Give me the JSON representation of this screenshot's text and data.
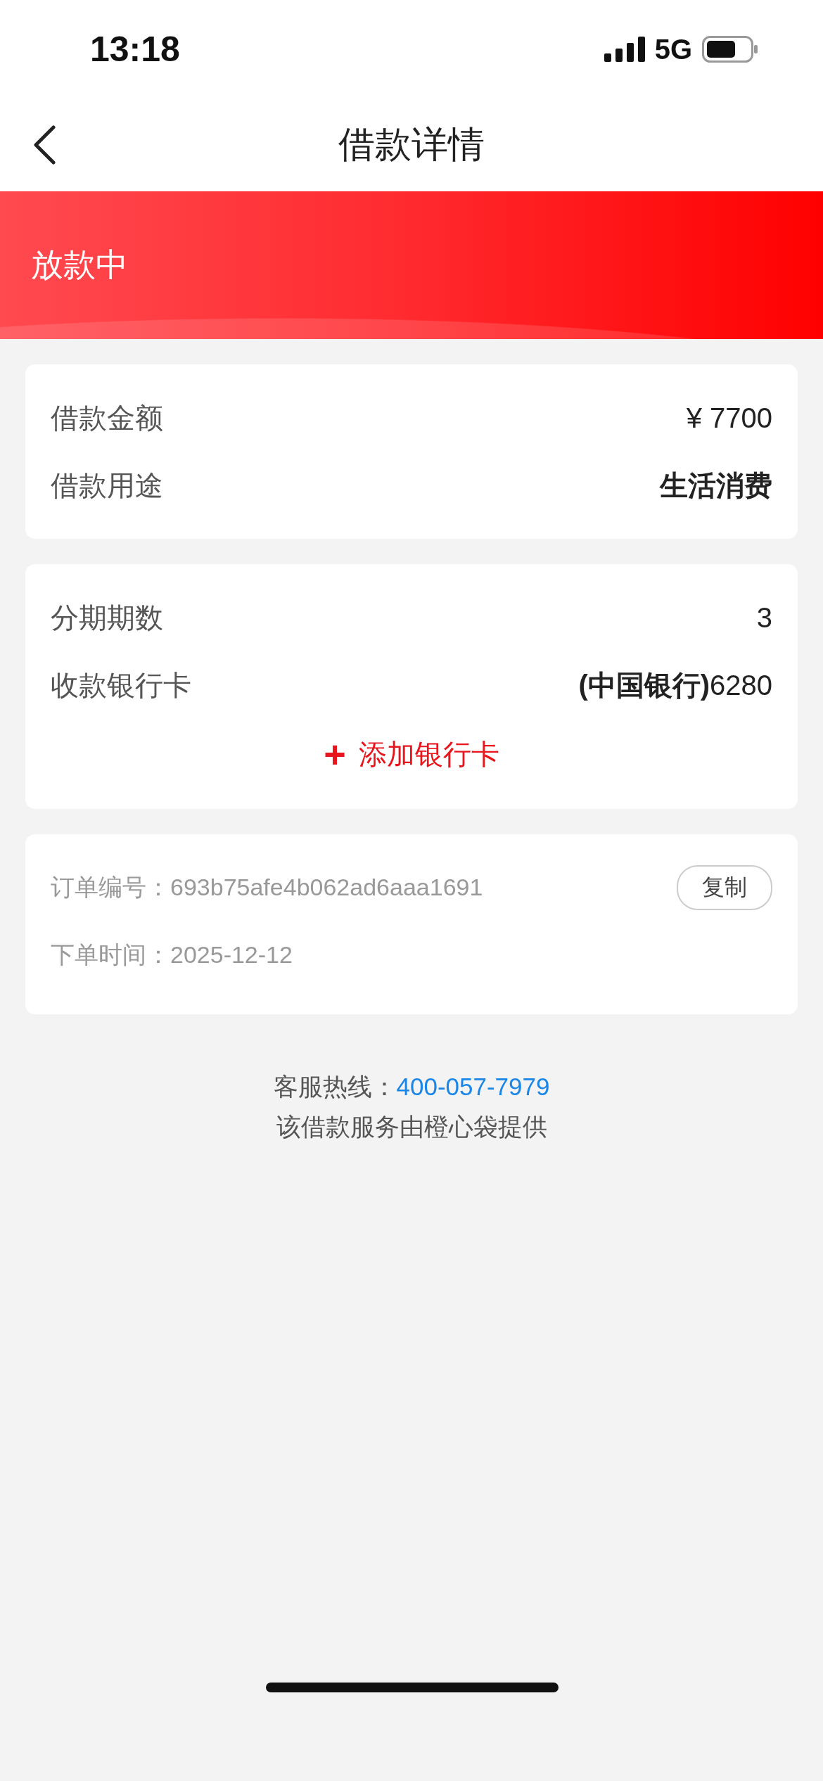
{
  "status_bar": {
    "time": "13:18",
    "network": "5G"
  },
  "nav": {
    "title": "借款详情"
  },
  "banner": {
    "status": "放款中"
  },
  "loan_card": {
    "rows": [
      {
        "label": "借款金额",
        "value": "¥ 7700",
        "bold": false
      },
      {
        "label": "借款用途",
        "value": "生活消费",
        "bold": true
      }
    ]
  },
  "installment_card": {
    "rows": [
      {
        "label": "分期期数",
        "value": "3",
        "bold": false
      },
      {
        "label": "收款银行卡",
        "value": "**(中国银行)**6280",
        "bold": false
      }
    ],
    "add_card": {
      "icon": "+",
      "label": "添加银行卡"
    }
  },
  "order_card": {
    "order_no": {
      "label": "订单编号：",
      "value": "693b75afe4b062ad6aaa1691"
    },
    "copy_button": "复制",
    "order_time": {
      "label": "下单时间：",
      "value": "2025-12-12"
    }
  },
  "footer": {
    "hotline_label": "客服热线：",
    "hotline": "400-057-7979",
    "provider": "该借款服务由橙心袋提供"
  }
}
